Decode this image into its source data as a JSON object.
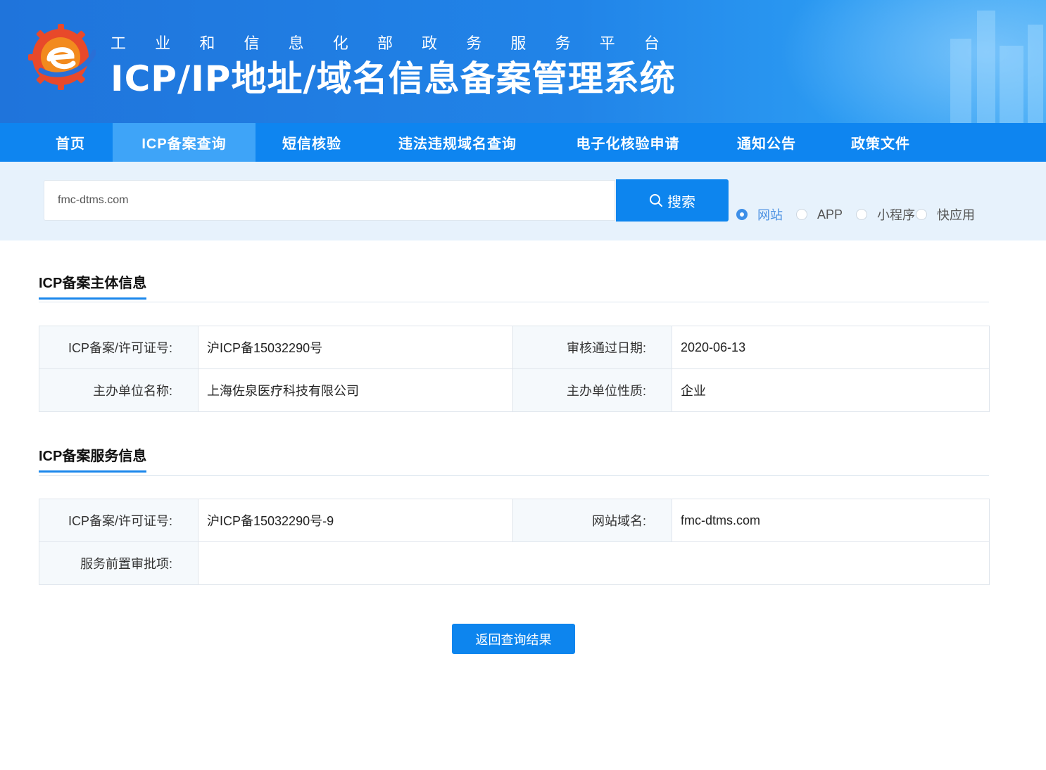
{
  "header": {
    "platform_chars": [
      "工",
      "业",
      "和",
      "信",
      "息",
      "化",
      "部",
      "政",
      "务",
      "服",
      "务",
      "平",
      "台"
    ],
    "system_title": "ICP/IP地址/域名信息备案管理系统",
    "logo_icon": "miit-e-logo-icon",
    "colors": {
      "banner": "#1f74db",
      "nav": "#0e85f0",
      "nav_active": "#3ea4f8",
      "accent": "#0d85ee"
    }
  },
  "nav": {
    "items": [
      {
        "label": "首页"
      },
      {
        "label": "ICP备案查询",
        "active": true
      },
      {
        "label": "短信核验"
      },
      {
        "label": "违法违规域名查询"
      },
      {
        "label": "电子化核验申请"
      },
      {
        "label": "通知公告"
      },
      {
        "label": "政策文件"
      }
    ]
  },
  "search": {
    "value": "fmc-dtms.com",
    "button_label": "搜索",
    "button_icon": "search-icon",
    "types": [
      {
        "label": "网站",
        "checked": true
      },
      {
        "label": "APP",
        "checked": false
      },
      {
        "label": "小程序",
        "checked": false
      },
      {
        "label": "快应用",
        "checked": false
      }
    ]
  },
  "subject": {
    "title": "ICP备案主体信息",
    "license_label": "ICP备案/许可证号:",
    "license_value": "沪ICP备15032290号",
    "date_label": "审核通过日期:",
    "date_value": "2020-06-13",
    "org_label": "主办单位名称:",
    "org_value": "上海佐泉医疗科技有限公司",
    "nature_label": "主办单位性质:",
    "nature_value": "企业"
  },
  "service": {
    "title": "ICP备案服务信息",
    "license_label": "ICP备案/许可证号:",
    "license_value": "沪ICP备15032290号-9",
    "domain_label": "网站域名:",
    "domain_value": "fmc-dtms.com",
    "approval_label": "服务前置审批项:",
    "approval_value": ""
  },
  "back_button": "返回查询结果"
}
